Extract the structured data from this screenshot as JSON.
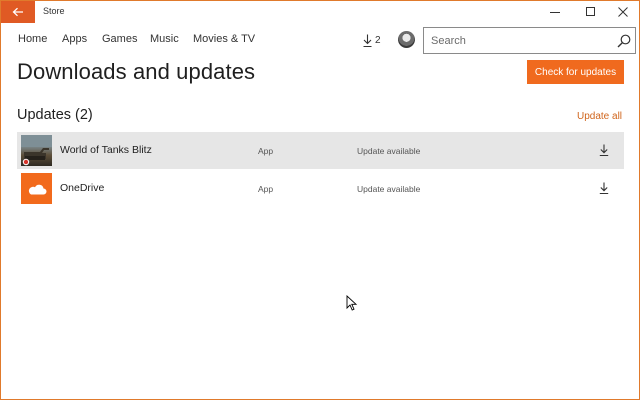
{
  "window": {
    "title": "Store",
    "accent": "#e05a24"
  },
  "nav": {
    "items": [
      "Home",
      "Apps",
      "Games",
      "Music",
      "Movies & TV"
    ],
    "downloads_count": "2",
    "search_placeholder": "Search"
  },
  "header": {
    "title": "Downloads and updates",
    "check_button": "Check for updates"
  },
  "updates": {
    "title": "Updates (2)",
    "update_all": "Update all",
    "items": [
      {
        "name": "World of Tanks Blitz",
        "type": "App",
        "status": "Update available",
        "icon": "world-of-tanks-blitz-icon"
      },
      {
        "name": "OneDrive",
        "type": "App",
        "status": "Update available",
        "icon": "onedrive-cloud-icon"
      }
    ]
  },
  "colors": {
    "accent_orange": "#f06a1e",
    "link_orange": "#d0651c",
    "selected_row": "#e6e6e6"
  }
}
